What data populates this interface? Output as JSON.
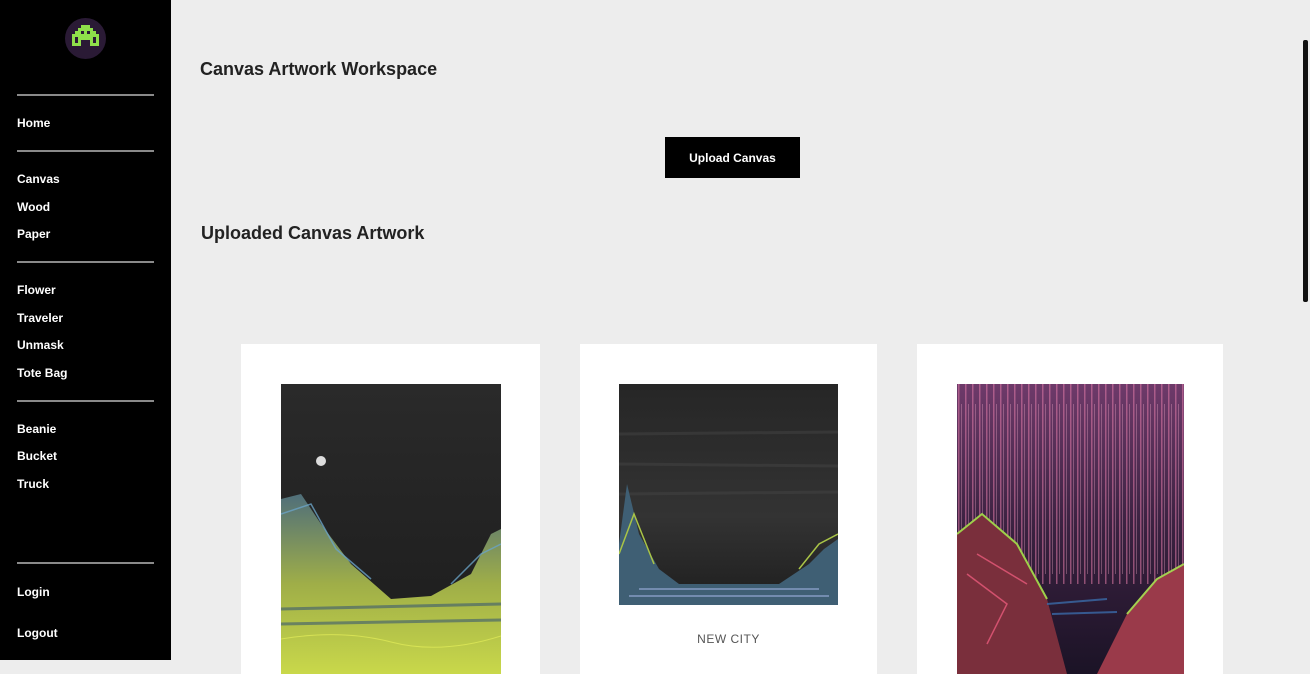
{
  "sidebar": {
    "logo_icon": "alien-invader-icon",
    "items": [
      {
        "label": "Home"
      },
      {
        "label": "Canvas"
      },
      {
        "label": "Wood"
      },
      {
        "label": "Paper"
      },
      {
        "label": "Flower"
      },
      {
        "label": "Traveler"
      },
      {
        "label": "Unmask"
      },
      {
        "label": "Tote Bag"
      },
      {
        "label": "Beanie"
      },
      {
        "label": "Bucket"
      },
      {
        "label": "Truck"
      },
      {
        "label": "Login"
      },
      {
        "label": "Logout"
      }
    ]
  },
  "main": {
    "title": "Canvas Artwork Workspace",
    "upload_label": "Upload Canvas",
    "section_title": "Uploaded Canvas Artwork",
    "artworks": [
      {
        "label": ""
      },
      {
        "label": "NEW CITY"
      },
      {
        "label": ""
      }
    ]
  },
  "colors": {
    "sidebar_bg": "#000000",
    "page_bg": "#ededed",
    "logo_accent": "#8fe04a",
    "button_bg": "#000000"
  }
}
